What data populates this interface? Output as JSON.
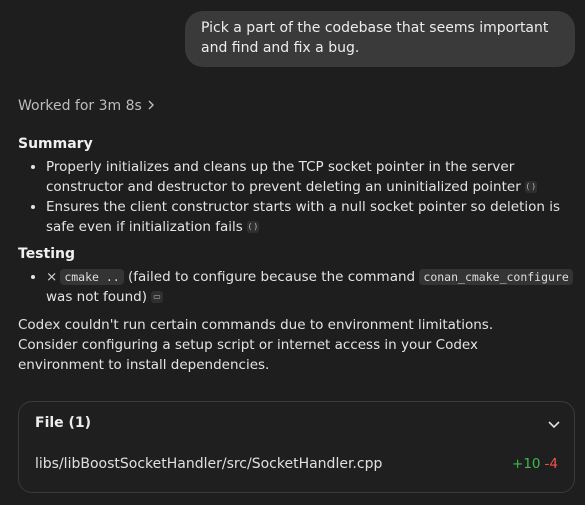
{
  "user_message": "Pick a part of the codebase that seems important and find and fix a bug.",
  "worked_for": "Worked for 3m 8s",
  "summary": {
    "heading": "Summary",
    "items": [
      "Properly initializes and cleans up the TCP socket pointer in the server constructor and destructor to prevent deleting an uninitialized pointer",
      "Ensures the client constructor starts with a null socket pointer so deletion is safe even if initialization fails"
    ]
  },
  "testing": {
    "heading": "Testing",
    "status_mark": "×",
    "command": "cmake ..",
    "text_before": "(failed to configure because the command",
    "failing_command": "conan_cmake_configure",
    "text_after": "was not found)"
  },
  "note": "Codex couldn't run certain commands due to environment limitations. Consider configuring a setup script or internet access in your Codex environment to install dependencies.",
  "file_card": {
    "title": "File (1)",
    "path": "libs/libBoostSocketHandler/src/SocketHandler.cpp",
    "additions": "+10",
    "deletions": "-4"
  },
  "colors": {
    "background": "#1e1e1e",
    "bubble": "#3a3a3a",
    "additions": "#3fb950",
    "deletions": "#f85149"
  },
  "icons": {
    "worked_chevron": "chevron-right-icon",
    "citation": "citation-icon",
    "terminal": "terminal-icon",
    "toggle": "chevron-down-icon"
  }
}
